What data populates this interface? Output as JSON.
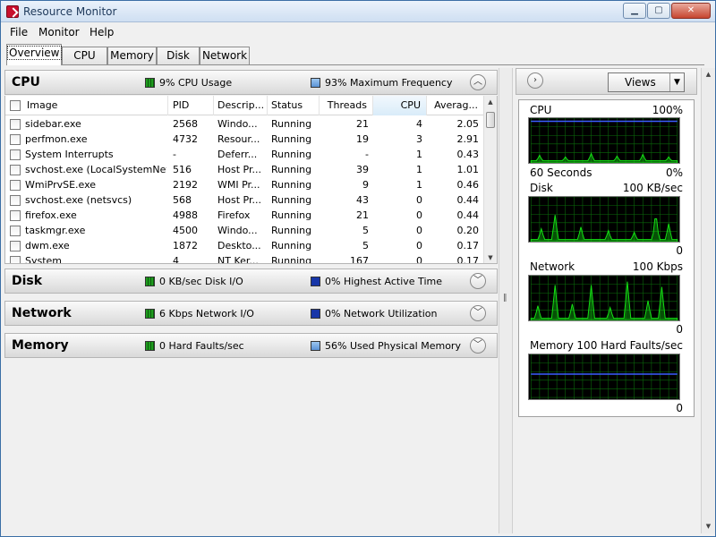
{
  "window": {
    "title": "Resource Monitor"
  },
  "menu": [
    "File",
    "Monitor",
    "Help"
  ],
  "tabs": [
    "Overview",
    "CPU",
    "Memory",
    "Disk",
    "Network"
  ],
  "cpu": {
    "title": "CPU",
    "metric1": "9% CPU Usage",
    "metric2": "93% Maximum Frequency",
    "columns": [
      "Image",
      "PID",
      "Descrip...",
      "Status",
      "Threads",
      "CPU",
      "Averag..."
    ],
    "rows": [
      [
        "sidebar.exe",
        "2568",
        "Windo...",
        "Running",
        "21",
        "4",
        "2.05"
      ],
      [
        "perfmon.exe",
        "4732",
        "Resour...",
        "Running",
        "19",
        "3",
        "2.91"
      ],
      [
        "System Interrupts",
        "-",
        "Deferr...",
        "Running",
        "-",
        "1",
        "0.43"
      ],
      [
        "svchost.exe (LocalSystemNet...",
        "516",
        "Host Pr...",
        "Running",
        "39",
        "1",
        "1.01"
      ],
      [
        "WmiPrvSE.exe",
        "2192",
        "WMI Pr...",
        "Running",
        "9",
        "1",
        "0.46"
      ],
      [
        "svchost.exe (netsvcs)",
        "568",
        "Host Pr...",
        "Running",
        "43",
        "0",
        "0.44"
      ],
      [
        "firefox.exe",
        "4988",
        "Firefox",
        "Running",
        "21",
        "0",
        "0.44"
      ],
      [
        "taskmgr.exe",
        "4500",
        "Windo...",
        "Running",
        "5",
        "0",
        "0.20"
      ],
      [
        "dwm.exe",
        "1872",
        "Deskto...",
        "Running",
        "5",
        "0",
        "0.17"
      ],
      [
        "System",
        "4",
        "NT Ker...",
        "Running",
        "167",
        "0",
        "0.17"
      ]
    ]
  },
  "disk": {
    "title": "Disk",
    "metric1": "0 KB/sec Disk I/O",
    "metric2": "0% Highest Active Time"
  },
  "network": {
    "title": "Network",
    "metric1": "6 Kbps Network I/O",
    "metric2": "0% Network Utilization"
  },
  "memory": {
    "title": "Memory",
    "metric1": "0 Hard Faults/sec",
    "metric2": "56% Used Physical Memory"
  },
  "views_label": "Views",
  "graphs": {
    "cpu": {
      "label": "CPU",
      "max": "100%",
      "footer_left": "60 Seconds",
      "footer_right": "0%",
      "usage": 0.09,
      "frequency": 0.93
    },
    "disk": {
      "label": "Disk",
      "max": "100 KB/sec",
      "footer_right": "0"
    },
    "network": {
      "label": "Network",
      "max": "100 Kbps",
      "footer_right": "0"
    },
    "memory": {
      "label": "Memory",
      "max": "100 Hard Faults/sec",
      "footer_right": "0",
      "used": 0.56
    }
  },
  "colors": {
    "graph_bg": "#000000",
    "graph_grid": "#0b6b0b",
    "graph_line": "#14e314",
    "freq_line": "#3c5cff",
    "title_text": "#1e395b"
  }
}
